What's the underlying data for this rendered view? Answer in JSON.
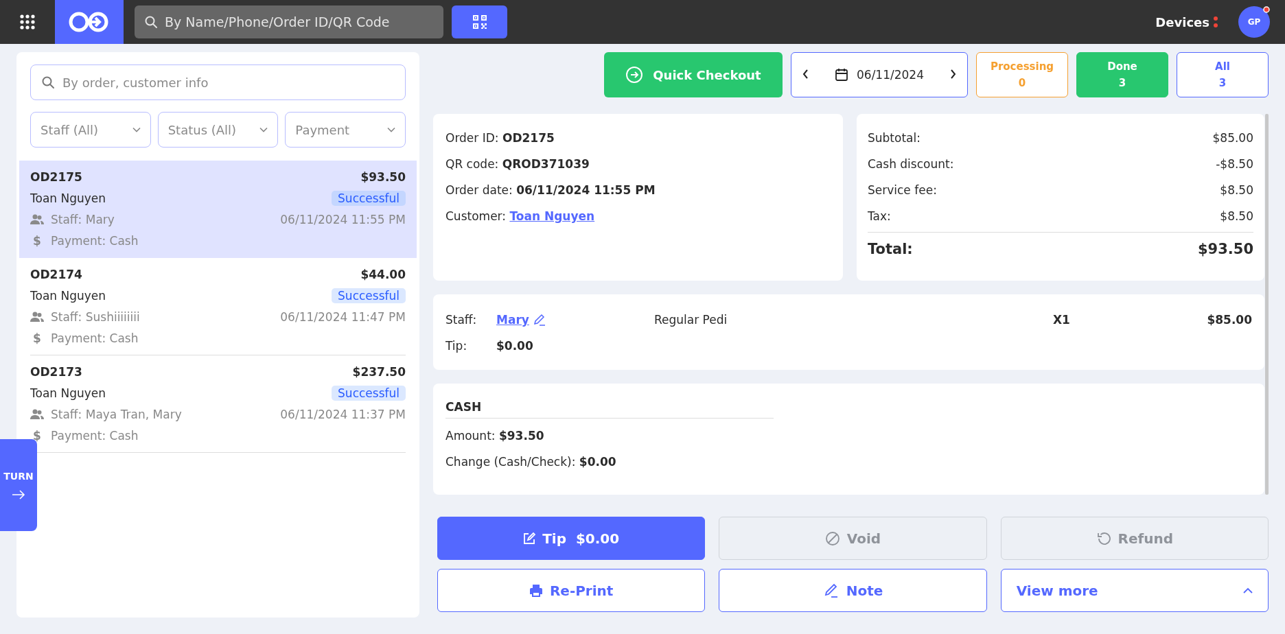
{
  "top_bar": {
    "search_placeholder": "By Name/Phone/Order ID/QR Code",
    "devices_label": "Devices",
    "avatar_initials": "GP"
  },
  "order_filters": {
    "search_placeholder": "By order, customer info",
    "dropdowns": [
      "Staff (All)",
      "Status (All)",
      "Payment"
    ]
  },
  "orders": [
    {
      "id": "OD2175",
      "amount": "$93.50",
      "customer": "Toan Nguyen",
      "status": "Successful",
      "staff": "Staff: Mary",
      "datetime": "06/11/2024 11:55 PM",
      "payment_icon": "$",
      "payment": "Payment: Cash",
      "selected": true
    },
    {
      "id": "OD2174",
      "amount": "$44.00",
      "customer": "Toan Nguyen",
      "status": "Successful",
      "staff": "Staff: Sushiiiiiiii",
      "datetime": "06/11/2024 11:47 PM",
      "payment_icon": "$",
      "payment": "Payment: Cash",
      "selected": false
    },
    {
      "id": "OD2173",
      "amount": "$237.50",
      "customer": "Toan Nguyen",
      "status": "Successful",
      "staff": "Staff: Maya Tran, Mary",
      "datetime": "06/11/2024 11:37 PM",
      "payment_icon": "$",
      "payment": "Payment: Cash",
      "selected": false
    }
  ],
  "turn_tab": {
    "label": "TURN"
  },
  "toolbar": {
    "quick_checkout": "Quick Checkout",
    "date": "06/11/2024",
    "status_tabs": [
      {
        "kind": "processing",
        "label": "Processing",
        "count": "0",
        "selected": false
      },
      {
        "kind": "done",
        "label": "Done",
        "count": "3",
        "selected": true
      },
      {
        "kind": "all",
        "label": "All",
        "count": "3",
        "selected": false
      }
    ]
  },
  "order_info": [
    {
      "label": "Order ID:",
      "value": "OD2175",
      "kind": "bold"
    },
    {
      "label": "QR code:",
      "value": "QROD371039",
      "kind": "bold"
    },
    {
      "label": "Order date:",
      "value": "06/11/2024 11:55 PM",
      "kind": "bold"
    },
    {
      "label": "Customer:",
      "value": "Toan Nguyen",
      "kind": "link"
    }
  ],
  "totals": {
    "rows": [
      {
        "label": "Subtotal:",
        "value": "$85.00"
      },
      {
        "label": "Cash discount:",
        "value": "-$8.50"
      },
      {
        "label": "Service fee:",
        "value": "$8.50"
      },
      {
        "label": "Tax:",
        "value": "$8.50"
      }
    ],
    "total_label": "Total:",
    "total_value": "$93.50"
  },
  "service": {
    "staff_label": "Staff:",
    "staff_name": "Mary",
    "tip_label": "Tip:",
    "tip_value": "$0.00",
    "service_name": "Regular Pedi",
    "quantity": "X1",
    "price": "$85.00"
  },
  "payment": {
    "method": "CASH",
    "lines": [
      {
        "label": "Amount:",
        "value": "$93.50"
      },
      {
        "label": "Change (Cash/Check):",
        "value": "$0.00"
      }
    ]
  },
  "actions": [
    {
      "kind": "tip",
      "label": "Tip",
      "amount": "$0.00",
      "disabled": false
    },
    {
      "kind": "void",
      "label": "Void",
      "disabled": true
    },
    {
      "kind": "refund",
      "label": "Refund",
      "disabled": true
    },
    {
      "kind": "reprint",
      "label": "Re-Print",
      "disabled": false
    },
    {
      "kind": "note",
      "label": "Note",
      "disabled": false
    },
    {
      "kind": "more",
      "label": "View more",
      "disabled": false
    }
  ]
}
